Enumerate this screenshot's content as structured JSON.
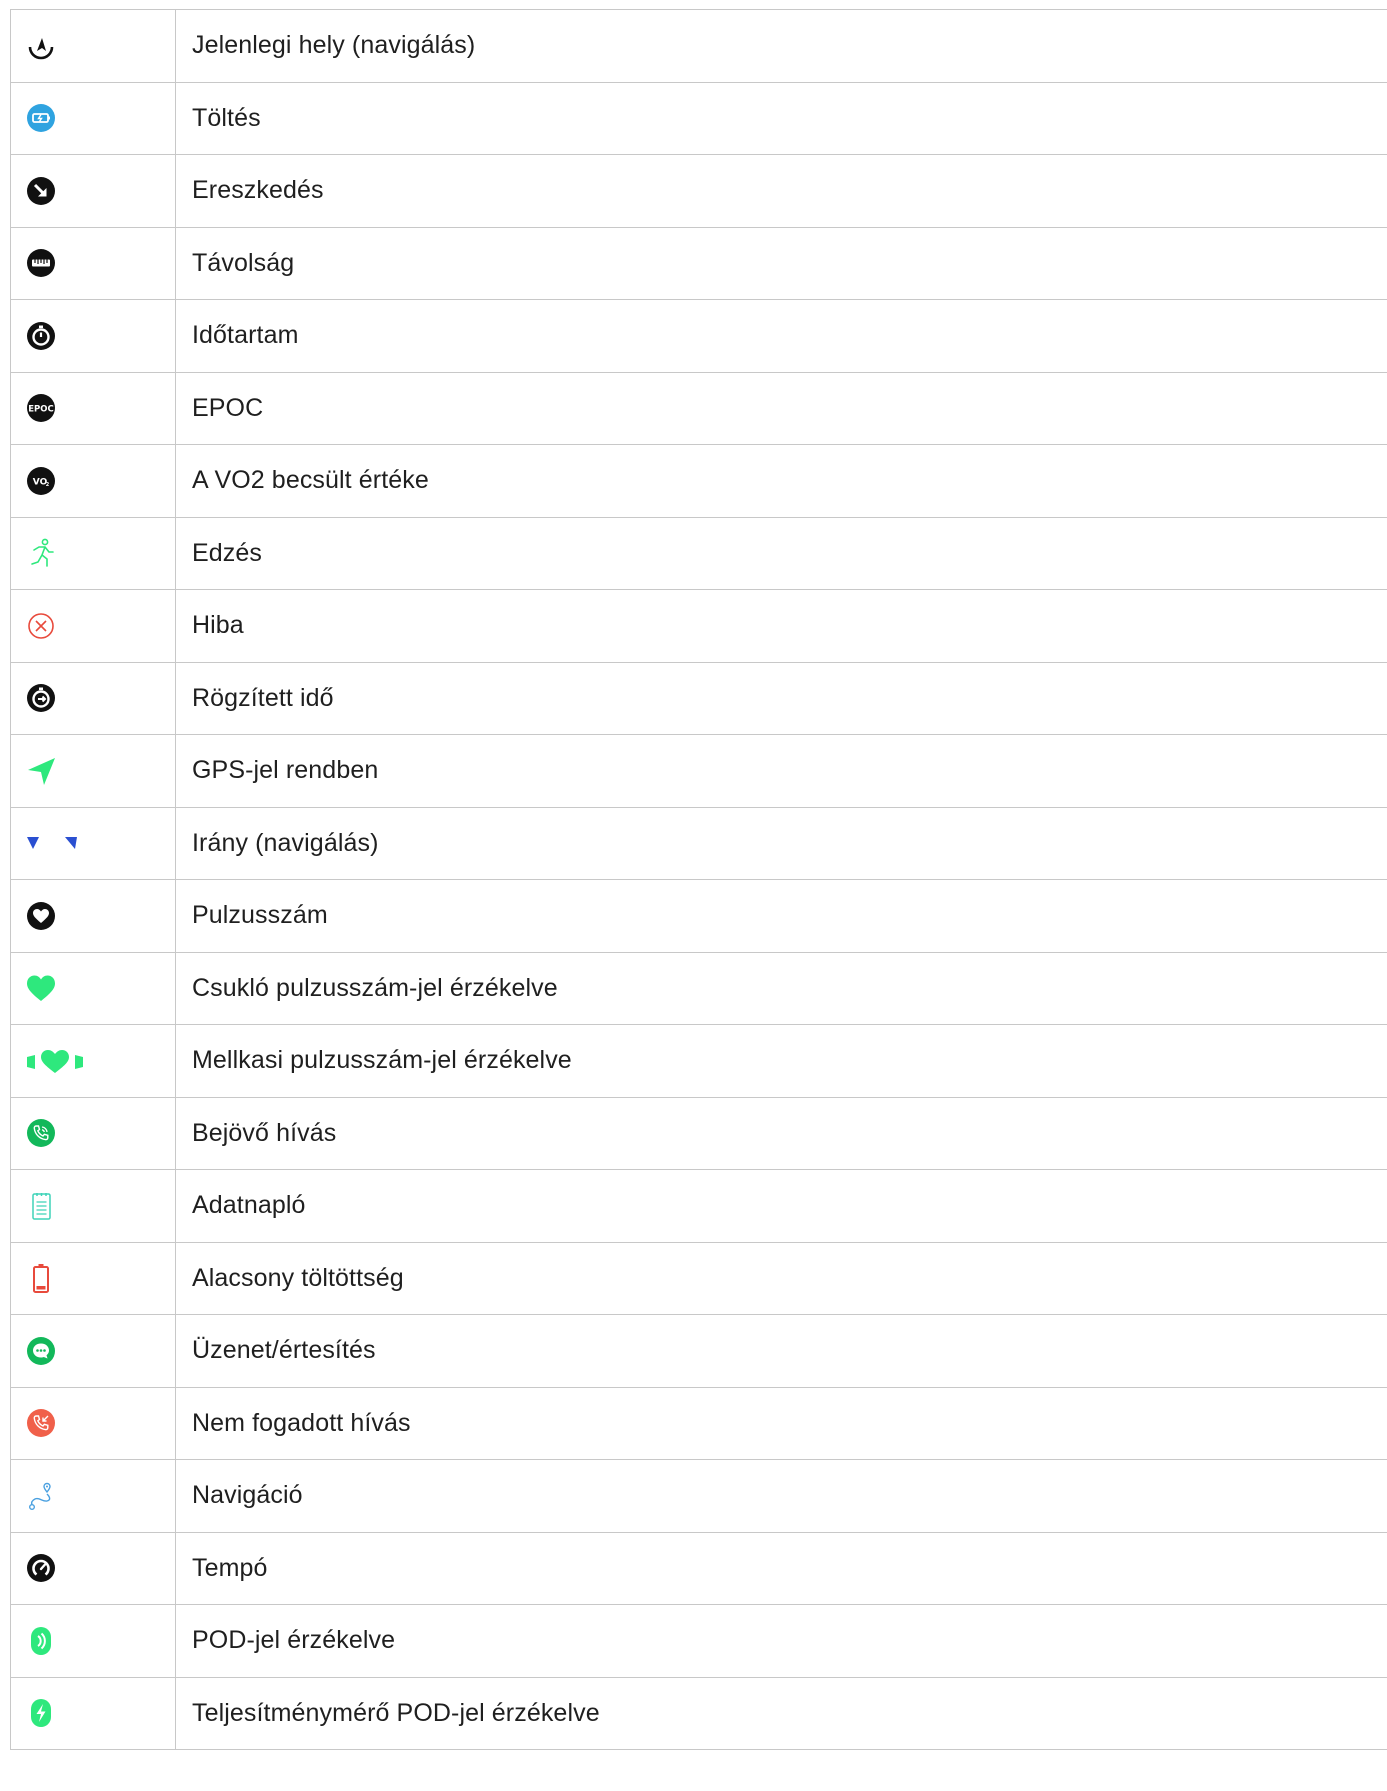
{
  "colors": {
    "black": "#111111",
    "blue_charge": "#2fa3e0",
    "green": "#2ee87d",
    "green_dark": "#12b85a",
    "red": "#e84a3c",
    "red_call": "#f0604a",
    "blue_dir": "#2a4fd1",
    "teal_log": "#3fd3b8",
    "nav_blue": "#4aa0e0",
    "border": "#c8c8c8"
  },
  "rows": [
    {
      "icon": "current-location-icon",
      "label": "Jelenlegi hely (navigálás)"
    },
    {
      "icon": "charging-icon",
      "label": "Töltés"
    },
    {
      "icon": "descent-icon",
      "label": "Ereszkedés"
    },
    {
      "icon": "distance-icon",
      "label": "Távolság"
    },
    {
      "icon": "duration-icon",
      "label": "Időtartam"
    },
    {
      "icon": "epoc-icon",
      "label": "EPOC"
    },
    {
      "icon": "vo2-icon",
      "label": "A VO2 becsült értéke"
    },
    {
      "icon": "exercise-icon",
      "label": "Edzés"
    },
    {
      "icon": "error-icon",
      "label": "Hiba"
    },
    {
      "icon": "logged-time-icon",
      "label": "Rögzített idő"
    },
    {
      "icon": "gps-ok-icon",
      "label": "GPS-jel rendben"
    },
    {
      "icon": "heading-icon",
      "label": "Irány (navigálás)"
    },
    {
      "icon": "heart-rate-icon",
      "label": "Pulzusszám"
    },
    {
      "icon": "wrist-hr-icon",
      "label": "Csukló pulzusszám-jel érzékelve"
    },
    {
      "icon": "chest-hr-icon",
      "label": "Mellkasi pulzusszám-jel érzékelve"
    },
    {
      "icon": "incoming-call-icon",
      "label": "Bejövő hívás"
    },
    {
      "icon": "logbook-icon",
      "label": "Adatnapló"
    },
    {
      "icon": "low-battery-icon",
      "label": "Alacsony töltöttség"
    },
    {
      "icon": "message-icon",
      "label": "Üzenet/értesítés"
    },
    {
      "icon": "missed-call-icon",
      "label": "Nem fogadott hívás"
    },
    {
      "icon": "navigation-icon",
      "label": "Navigáció"
    },
    {
      "icon": "pace-icon",
      "label": "Tempó"
    },
    {
      "icon": "pod-icon",
      "label": "POD-jel érzékelve"
    },
    {
      "icon": "power-pod-icon",
      "label": "Teljesítménymérő POD-jel érzékelve"
    }
  ]
}
